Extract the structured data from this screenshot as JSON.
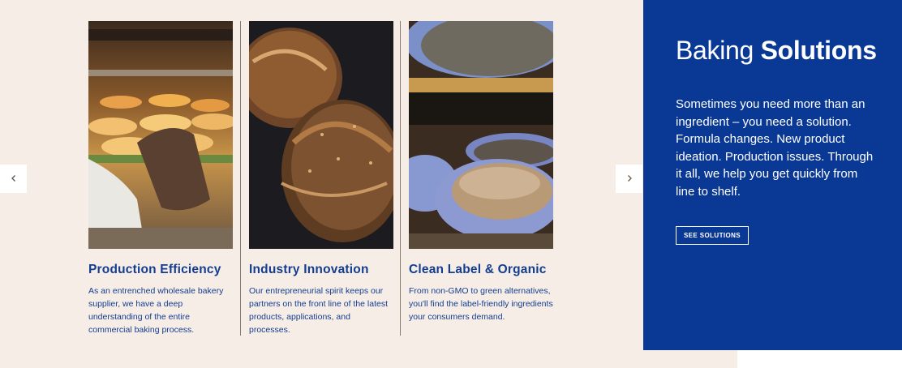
{
  "panel": {
    "title_light": "Baking",
    "title_bold": "Solutions",
    "body": "Sometimes you need more than an ingredient – you need a solution. Formula changes. New product ideation. Production issues. Through it all, we help you get quickly from line to shelf.",
    "button_label": "SEE SOLUTIONS"
  },
  "carousel": {
    "prev_icon": "chevron-left-icon",
    "next_icon": "chevron-right-icon",
    "cards": [
      {
        "title": "Production Efficiency",
        "description": "As an entrenched wholesale bakery supplier, we have a deep understanding of the entire commercial baking process.",
        "image": "oven-baguettes-photo"
      },
      {
        "title": "Industry Innovation",
        "description": "Our entrepreneurial spirit keeps our partners on the front line of the latest products, applications, and processes.",
        "image": "artisan-bread-loaves-photo"
      },
      {
        "title": "Clean Label & Organic",
        "description": "From non-GMO to green alternatives, you'll find the label-friendly ingredients your consumers demand.",
        "image": "proofing-baskets-photo"
      }
    ]
  },
  "colors": {
    "panel_bg": "#0a3995",
    "page_bg": "#f6ede6",
    "title_blue": "#143d8f"
  }
}
